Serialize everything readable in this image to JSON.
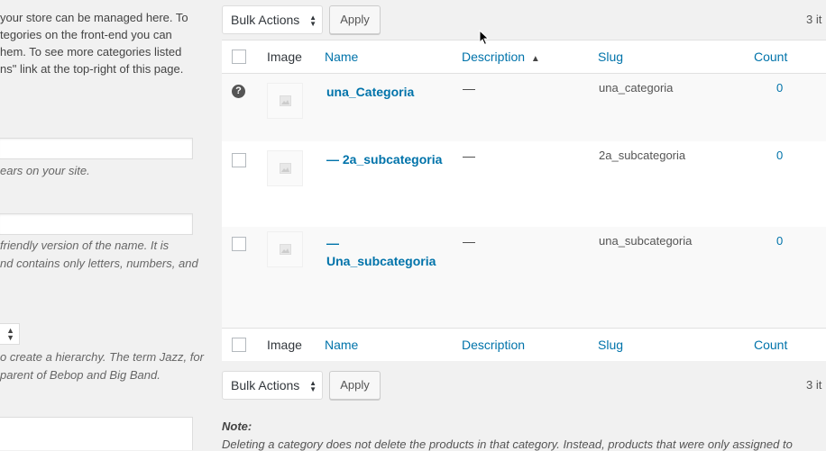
{
  "left_panel": {
    "intro_lines": [
      "your store can be managed here. To",
      "tegories on the front-end you can",
      "hem. To see more categories listed",
      "ns\" link at the top-right of this page."
    ],
    "name_desc": "ears on your site.",
    "slug_desc_lines": [
      "friendly version of the name. It is",
      "nd contains only letters, numbers, and"
    ],
    "parent_desc_lines": [
      "o create a hierarchy. The term Jazz, for",
      " parent of Bebop and Big Band."
    ]
  },
  "tablenav_top": {
    "bulk_label": "Bulk Actions",
    "apply_label": "Apply",
    "items_count": "3 it"
  },
  "tablenav_bottom": {
    "bulk_label": "Bulk Actions",
    "apply_label": "Apply",
    "items_count": "3 it"
  },
  "table": {
    "headers": {
      "image": "Image",
      "name": "Name",
      "description": "Description",
      "sort_indicator": "▲",
      "slug": "Slug",
      "count": "Count"
    },
    "rows": [
      {
        "name": "una_Categoria",
        "description": "—",
        "slug": "una_categoria",
        "count": "0"
      },
      {
        "name": "— 2a_subcategoria",
        "description": "—",
        "slug": "2a_subcategoria",
        "count": "0"
      },
      {
        "name": "— Una_subcategoria",
        "description": "—",
        "slug": "una_subcategoria",
        "count": "0"
      }
    ]
  },
  "note": {
    "title": "Note:",
    "text": "Deleting a category does not delete the products in that category. Instead, products that were only assigned to"
  },
  "colors": {
    "link": "#0073aa",
    "background": "#f1f1f1"
  }
}
